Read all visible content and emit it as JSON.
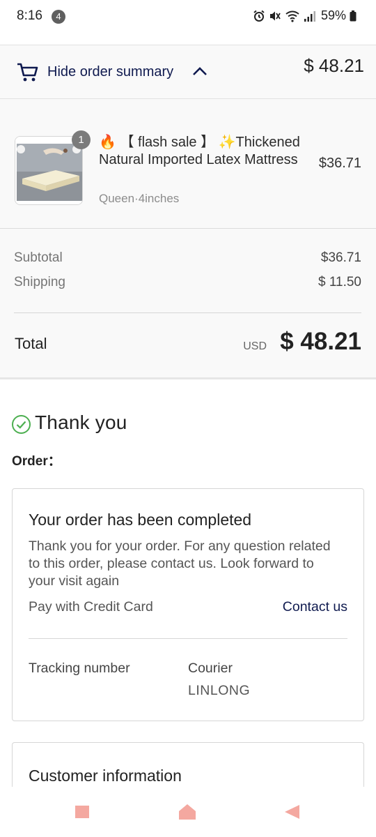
{
  "status_bar": {
    "time": "8:16",
    "notification_count": "4",
    "battery": "59%"
  },
  "summary_toggle": {
    "label": "Hide order summary",
    "total": "$ 48.21"
  },
  "product": {
    "quantity": "1",
    "fire_emoji": "🔥",
    "title_part1": "【 flash sale 】",
    "sparkle_emoji": "✨",
    "title_part2": "Thickened Natural Imported Latex Mattress",
    "variant": "Queen·4inches",
    "price": "$36.71"
  },
  "totals": {
    "subtotal_label": "Subtotal",
    "subtotal_value": "$36.71",
    "shipping_label": "Shipping",
    "shipping_value": "$ 11.50",
    "total_label": "Total",
    "currency": "USD",
    "total_value": "$ 48.21"
  },
  "thank_you": {
    "heading": "Thank you",
    "order_label": "Order："
  },
  "completed_card": {
    "title": "Your order has been completed",
    "message": "Thank you for your order. For any question related to this order, please contact us. Look forward to your visit again",
    "payment": "Pay with Credit Card",
    "contact_link": "Contact us",
    "tracking_label": "Tracking number",
    "courier_label": "Courier",
    "courier_value": "LINLONG"
  },
  "customer_card": {
    "title": "Customer information"
  },
  "colors": {
    "accent": "#0f1a4f",
    "success": "#4caf50",
    "nav_buttons": "#f4a8a0"
  }
}
